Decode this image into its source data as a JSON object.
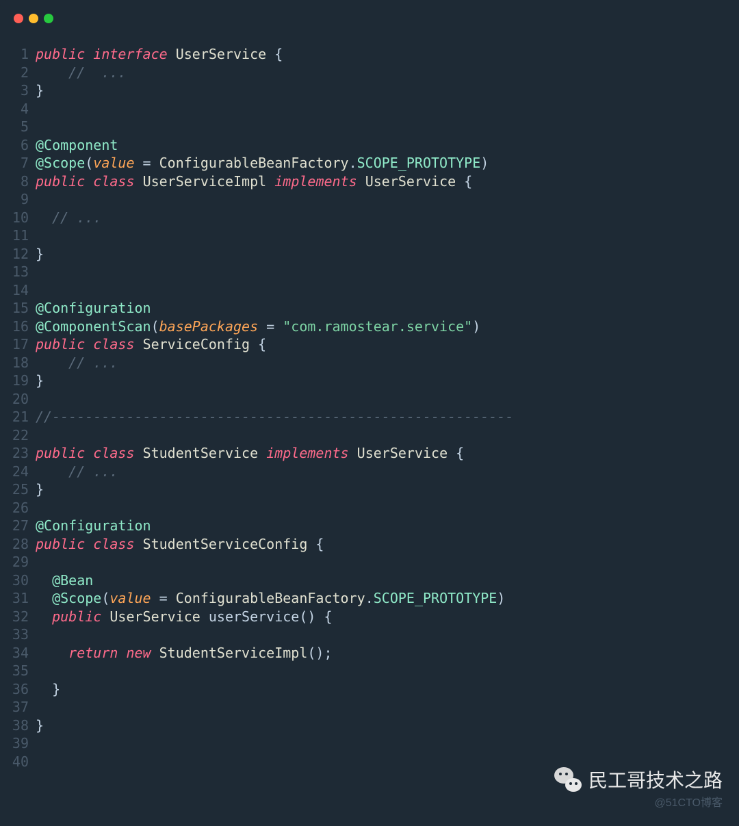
{
  "window": {
    "dots": [
      "red",
      "yellow",
      "green"
    ]
  },
  "code": {
    "lines": [
      {
        "n": 1,
        "t": [
          [
            "kw",
            "public"
          ],
          [
            "",
            ""
          ],
          [
            "",
            " "
          ],
          [
            "kw",
            "interface"
          ],
          [
            "",
            " "
          ],
          [
            "type",
            "UserService"
          ],
          [
            "",
            " {"
          ]
        ]
      },
      {
        "n": 2,
        "t": [
          [
            "",
            "    "
          ],
          [
            "cmt",
            "//  ..."
          ]
        ]
      },
      {
        "n": 3,
        "t": [
          [
            "",
            "}"
          ]
        ]
      },
      {
        "n": 4,
        "t": []
      },
      {
        "n": 5,
        "t": []
      },
      {
        "n": 6,
        "t": [
          [
            "ann",
            "@Component"
          ]
        ]
      },
      {
        "n": 7,
        "t": [
          [
            "ann",
            "@Scope"
          ],
          [
            "",
            "("
          ],
          [
            "param",
            "value"
          ],
          [
            "",
            " = "
          ],
          [
            "type",
            "ConfigurableBeanFactory"
          ],
          [
            "",
            "."
          ],
          [
            "const",
            "SCOPE_PROTOTYPE"
          ],
          [
            "",
            ")"
          ]
        ]
      },
      {
        "n": 8,
        "t": [
          [
            "kw",
            "public"
          ],
          [
            "",
            " "
          ],
          [
            "kw",
            "class"
          ],
          [
            "",
            " "
          ],
          [
            "type",
            "UserServiceImpl"
          ],
          [
            "",
            " "
          ],
          [
            "kw",
            "implements"
          ],
          [
            "",
            " "
          ],
          [
            "type",
            "UserService"
          ],
          [
            "",
            " {"
          ]
        ]
      },
      {
        "n": 9,
        "t": []
      },
      {
        "n": 10,
        "t": [
          [
            "",
            "  "
          ],
          [
            "cmt",
            "// ..."
          ]
        ]
      },
      {
        "n": 11,
        "t": []
      },
      {
        "n": 12,
        "t": [
          [
            "",
            "}"
          ]
        ]
      },
      {
        "n": 13,
        "t": []
      },
      {
        "n": 14,
        "t": []
      },
      {
        "n": 15,
        "t": [
          [
            "ann",
            "@Configuration"
          ]
        ]
      },
      {
        "n": 16,
        "t": [
          [
            "ann",
            "@ComponentScan"
          ],
          [
            "",
            "("
          ],
          [
            "param",
            "basePackages"
          ],
          [
            "",
            " = "
          ],
          [
            "str",
            "\"com.ramostear.service\""
          ],
          [
            "",
            ")"
          ]
        ]
      },
      {
        "n": 17,
        "t": [
          [
            "kw",
            "public"
          ],
          [
            "",
            " "
          ],
          [
            "kw",
            "class"
          ],
          [
            "",
            " "
          ],
          [
            "type",
            "ServiceConfig"
          ],
          [
            "",
            " {"
          ]
        ]
      },
      {
        "n": 18,
        "t": [
          [
            "",
            "    "
          ],
          [
            "cmt",
            "// ..."
          ]
        ]
      },
      {
        "n": 19,
        "t": [
          [
            "",
            "}"
          ]
        ]
      },
      {
        "n": 20,
        "t": []
      },
      {
        "n": 21,
        "t": [
          [
            "cmt",
            "//--------------------------------------------------------"
          ]
        ]
      },
      {
        "n": 22,
        "t": []
      },
      {
        "n": 23,
        "t": [
          [
            "kw",
            "public"
          ],
          [
            "",
            " "
          ],
          [
            "kw",
            "class"
          ],
          [
            "",
            " "
          ],
          [
            "type",
            "StudentService"
          ],
          [
            "",
            " "
          ],
          [
            "kw",
            "implements"
          ],
          [
            "",
            " "
          ],
          [
            "type",
            "UserService"
          ],
          [
            "",
            " {"
          ]
        ]
      },
      {
        "n": 24,
        "t": [
          [
            "",
            "    "
          ],
          [
            "cmt",
            "// ..."
          ]
        ]
      },
      {
        "n": 25,
        "t": [
          [
            "",
            "}"
          ]
        ]
      },
      {
        "n": 26,
        "t": []
      },
      {
        "n": 27,
        "t": [
          [
            "ann",
            "@Configuration"
          ]
        ]
      },
      {
        "n": 28,
        "t": [
          [
            "kw",
            "public"
          ],
          [
            "",
            " "
          ],
          [
            "kw",
            "class"
          ],
          [
            "",
            " "
          ],
          [
            "type",
            "StudentServiceConfig"
          ],
          [
            "",
            " {"
          ]
        ]
      },
      {
        "n": 29,
        "t": []
      },
      {
        "n": 30,
        "t": [
          [
            "",
            "  "
          ],
          [
            "ann",
            "@Bean"
          ]
        ]
      },
      {
        "n": 31,
        "t": [
          [
            "",
            "  "
          ],
          [
            "ann",
            "@Scope"
          ],
          [
            "",
            "("
          ],
          [
            "param",
            "value"
          ],
          [
            "",
            " = "
          ],
          [
            "type",
            "ConfigurableBeanFactory"
          ],
          [
            "",
            "."
          ],
          [
            "const",
            "SCOPE_PROTOTYPE"
          ],
          [
            "",
            ")"
          ]
        ]
      },
      {
        "n": 32,
        "t": [
          [
            "",
            "  "
          ],
          [
            "kw",
            "public"
          ],
          [
            "",
            " "
          ],
          [
            "type",
            "UserService"
          ],
          [
            "",
            " "
          ],
          [
            "",
            "userService"
          ],
          [
            "",
            "() {"
          ]
        ]
      },
      {
        "n": 33,
        "t": []
      },
      {
        "n": 34,
        "t": [
          [
            "",
            "    "
          ],
          [
            "kw",
            "return"
          ],
          [
            "",
            " "
          ],
          [
            "kw",
            "new"
          ],
          [
            "",
            " "
          ],
          [
            "type",
            "StudentServiceImpl"
          ],
          [
            "",
            "();"
          ]
        ]
      },
      {
        "n": 35,
        "t": []
      },
      {
        "n": 36,
        "t": [
          [
            "",
            "  }"
          ]
        ]
      },
      {
        "n": 37,
        "t": []
      },
      {
        "n": 38,
        "t": [
          [
            "",
            "}"
          ]
        ]
      },
      {
        "n": 39,
        "t": []
      },
      {
        "n": 40,
        "t": []
      }
    ]
  },
  "watermark": {
    "main": "民工哥技术之路",
    "sub": "@51CTO博客"
  }
}
